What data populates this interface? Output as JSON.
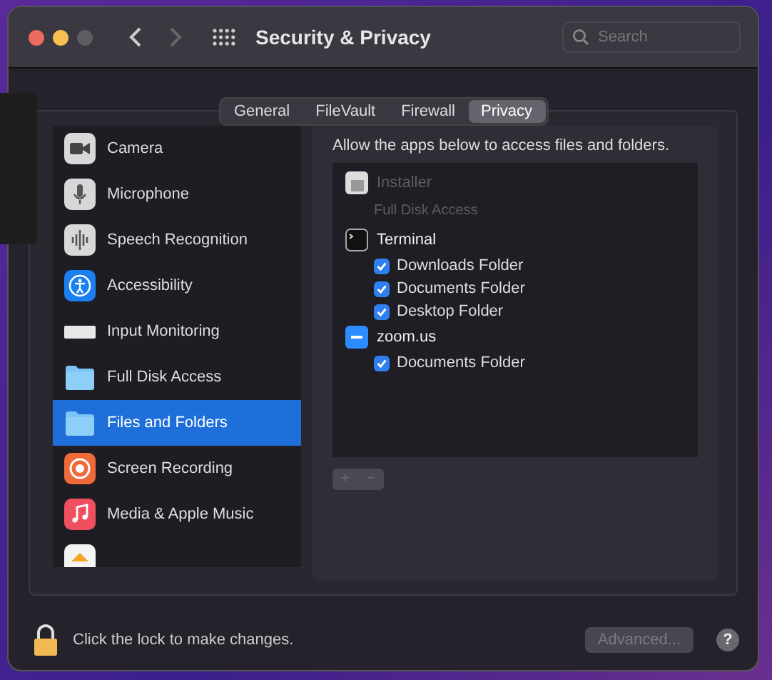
{
  "window": {
    "title": "Security & Privacy"
  },
  "search": {
    "placeholder": "Search"
  },
  "tabs": [
    {
      "label": "General",
      "selected": false
    },
    {
      "label": "FileVault",
      "selected": false
    },
    {
      "label": "Firewall",
      "selected": false
    },
    {
      "label": "Privacy",
      "selected": true
    }
  ],
  "sidebar": {
    "items": [
      {
        "label": "Camera",
        "selected": false
      },
      {
        "label": "Microphone",
        "selected": false
      },
      {
        "label": "Speech Recognition",
        "selected": false
      },
      {
        "label": "Accessibility",
        "selected": false
      },
      {
        "label": "Input Monitoring",
        "selected": false
      },
      {
        "label": "Full Disk Access",
        "selected": false
      },
      {
        "label": "Files and Folders",
        "selected": true
      },
      {
        "label": "Screen Recording",
        "selected": false
      },
      {
        "label": "Media & Apple Music",
        "selected": false
      },
      {
        "selected": false
      }
    ]
  },
  "panel": {
    "description": "Allow the apps below to access files and folders.",
    "apps": [
      {
        "name": "Installer",
        "disabled": true,
        "note": "Full Disk Access"
      },
      {
        "name": "Terminal",
        "disabled": false,
        "folders": [
          {
            "label": "Downloads Folder",
            "checked": true
          },
          {
            "label": "Documents Folder",
            "checked": true
          },
          {
            "label": "Desktop Folder",
            "checked": true
          }
        ]
      },
      {
        "name": "zoom.us",
        "disabled": false,
        "folders": [
          {
            "label": "Documents Folder",
            "checked": true
          }
        ]
      }
    ],
    "add_label": "+",
    "remove_label": "−"
  },
  "footer": {
    "lock_text": "Click the lock to make changes.",
    "advanced_label": "Advanced...",
    "help_label": "?"
  }
}
